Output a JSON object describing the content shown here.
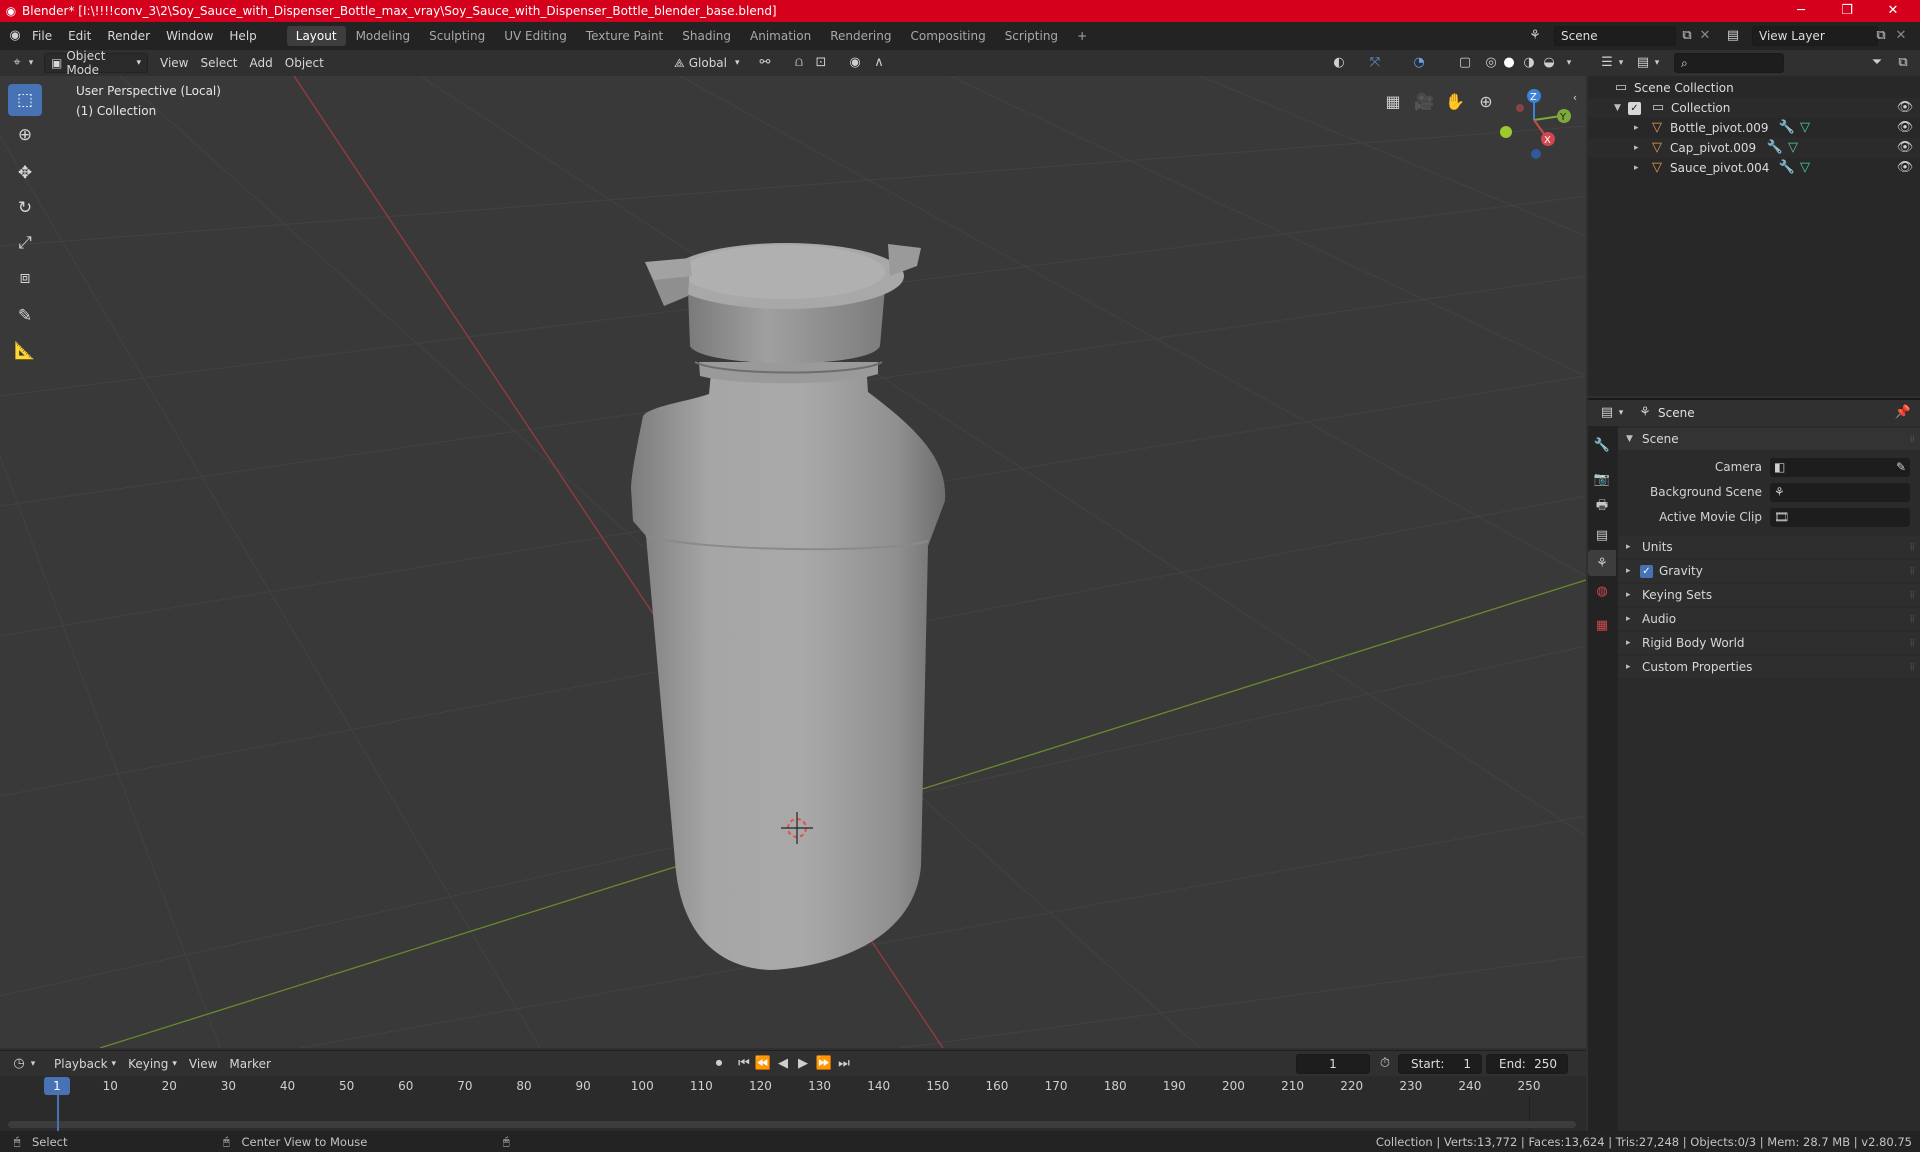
{
  "window": {
    "title": "Blender* [I:\\!!!!conv_3\\2\\Soy_Sauce_with_Dispenser_Bottle_max_vray\\Soy_Sauce_with_Dispenser_Bottle_blender_base.blend]",
    "controls": {
      "minimize": "─",
      "maximize": "❐",
      "close": "✕"
    }
  },
  "menubar": {
    "items": [
      "File",
      "Edit",
      "Render",
      "Window",
      "Help"
    ],
    "workspaces": [
      "Layout",
      "Modeling",
      "Sculpting",
      "UV Editing",
      "Texture Paint",
      "Shading",
      "Animation",
      "Rendering",
      "Compositing",
      "Scripting"
    ],
    "active_workspace": "Layout",
    "add_tab": "+",
    "scene": "Scene",
    "view_layer": "View Layer"
  },
  "viewport_header": {
    "mode": "Object Mode",
    "menus": [
      "View",
      "Select",
      "Add",
      "Object"
    ],
    "transform_orientation": "Global"
  },
  "viewport": {
    "perspective_label": "User Perspective (Local)",
    "collection_label": "(1) Collection",
    "gizmo_axes": {
      "z": "Z",
      "y": "Y",
      "x": "X"
    }
  },
  "outliner": {
    "search_placeholder": "",
    "root": "Scene Collection",
    "collection": "Collection",
    "objects": [
      "Bottle_pivot.009",
      "Cap_pivot.009",
      "Sauce_pivot.004"
    ]
  },
  "properties": {
    "context": "Scene",
    "panel_title": "Scene",
    "fields": [
      {
        "label": "Camera",
        "value": ""
      },
      {
        "label": "Background Scene",
        "value": ""
      },
      {
        "label": "Active Movie Clip",
        "value": ""
      }
    ],
    "sections": [
      "Units",
      "Gravity",
      "Keying Sets",
      "Audio",
      "Rigid Body World",
      "Custom Properties"
    ],
    "gravity_enabled": true
  },
  "timeline": {
    "menus": [
      "Playback",
      "Keying",
      "View",
      "Marker"
    ],
    "current_frame": "1",
    "start_label": "Start:",
    "start": "1",
    "end_label": "End:",
    "end": "250",
    "ticks": [
      "1",
      "10",
      "20",
      "30",
      "40",
      "50",
      "60",
      "70",
      "80",
      "90",
      "100",
      "110",
      "120",
      "130",
      "140",
      "150",
      "160",
      "170",
      "180",
      "190",
      "200",
      "210",
      "220",
      "230",
      "240",
      "250"
    ]
  },
  "statusbar": {
    "left_action": "Select",
    "middle_action": "Center View to Mouse",
    "stats": "Collection | Verts:13,772 | Faces:13,624 | Tris:27,248 | Objects:0/3 | Mem: 28.7 MB | v2.80.75"
  },
  "colors": {
    "accent": "#4772b3",
    "title_bar": "#d4001c",
    "x_axis": "#d0474f",
    "y_axis": "#7da83a",
    "z_axis": "#3e82d6"
  }
}
